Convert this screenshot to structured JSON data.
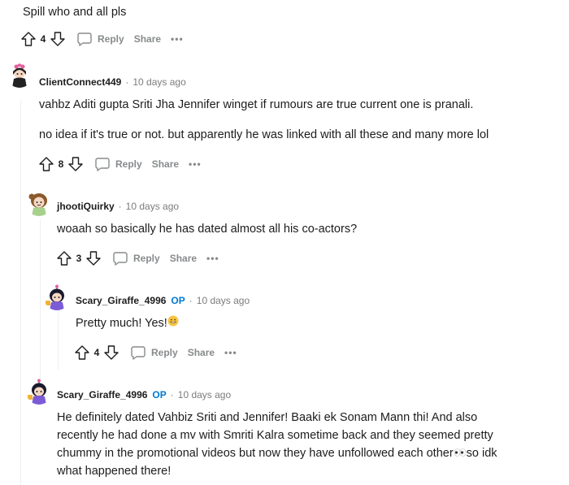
{
  "comment0": {
    "text": "Spill who and all pls",
    "votes": "4",
    "reply_label": "Reply",
    "share_label": "Share",
    "more_label": "•••"
  },
  "comment1": {
    "author": "ClientConnect449",
    "time": "10 days ago",
    "line1": "vahbz Aditi gupta Sriti Jha Jennifer winget if rumours are true current one is pranali.",
    "line2": "no idea if it's true or not. but apparently he was linked with all these and many more lol",
    "votes": "8",
    "reply_label": "Reply",
    "share_label": "Share",
    "more_label": "•••"
  },
  "comment2": {
    "author": "jhootiQuirky",
    "time": "10 days ago",
    "text": "woaah so basically he has dated almost all his co-actors?",
    "votes": "3",
    "reply_label": "Reply",
    "share_label": "Share",
    "more_label": "•••"
  },
  "comment3": {
    "author": "Scary_Giraffe_4996",
    "op_label": "OP",
    "time": "10 days ago",
    "text": "Pretty much! Yes!",
    "votes": "4",
    "reply_label": "Reply",
    "share_label": "Share",
    "more_label": "•••"
  },
  "comment4": {
    "author": "Scary_Giraffe_4996",
    "op_label": "OP",
    "time": "10 days ago",
    "line1": "He definitely dated Vahbiz Sriti and Jennifer! Baaki ek Sonam Mann thi! And also",
    "line2": "recently he had done a mv with Smriti Kalra sometime back and they seemed pretty",
    "line3a": "chummy in the promotional videos but now they have unfollowed each other",
    "line3b": "so idk",
    "line4": "what happened there!"
  },
  "icons": {
    "upvote": "upvote-arrow-icon",
    "downvote": "downvote-arrow-icon",
    "reply": "speech-bubble-icon",
    "grin": "grinning-face-emoji",
    "eyes": "eyes-emoji"
  },
  "colors": {
    "op": "#0079d3",
    "meta": "#7c7c7c",
    "action": "#878a8c",
    "thread": "#edeff1"
  }
}
